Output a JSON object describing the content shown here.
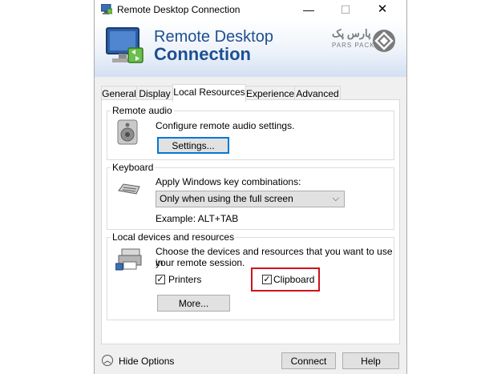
{
  "window": {
    "title": "Remote Desktop Connection",
    "min_glyph": "—",
    "max_glyph": "☐",
    "close_glyph": "✕"
  },
  "banner": {
    "line1": "Remote Desktop",
    "line2": "Connection",
    "logo_fa": "پارس پک",
    "logo_en": "PARS PACK"
  },
  "tabs": [
    "General",
    "Display",
    "Local Resources",
    "Experience",
    "Advanced"
  ],
  "active_tab": "Local Resources",
  "remote_audio": {
    "title": "Remote audio",
    "description": "Configure remote audio settings.",
    "settings_button": "Settings..."
  },
  "keyboard": {
    "title": "Keyboard",
    "description": "Apply Windows key combinations:",
    "selected": "Only when using the full screen",
    "example": "Example: ALT+TAB"
  },
  "local_devices": {
    "title": "Local devices and resources",
    "description_line1": "Choose the devices and resources that you want to use in",
    "description_line2": "your remote session.",
    "printers_label": "Printers",
    "printers_checked": true,
    "clipboard_label": "Clipboard",
    "clipboard_checked": true,
    "more_button": "More..."
  },
  "footer": {
    "hide_options": "Hide Options",
    "connect": "Connect",
    "help": "Help"
  },
  "colors": {
    "title_blue": "#1d4f91",
    "highlight_red": "#d0121b",
    "focus_blue": "#0078d7"
  }
}
